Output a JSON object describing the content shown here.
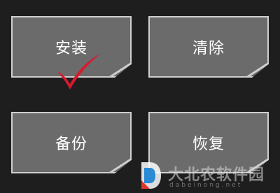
{
  "tiles": {
    "install": "安装",
    "clear": "清除",
    "backup": "备份",
    "restore": "恢复"
  },
  "selected": "install",
  "colors": {
    "background": "#1e1e1e",
    "tile_fill": "#6b6b6b",
    "tile_border": "#cfcfcf",
    "checkmark": "#d8192e"
  },
  "watermark": {
    "name": "大北农软件园",
    "domain": "dabeinong.net"
  }
}
